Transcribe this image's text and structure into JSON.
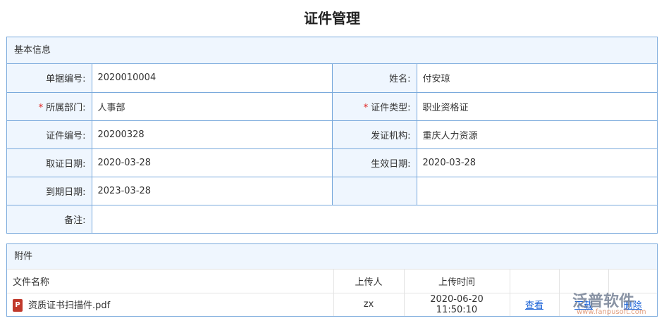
{
  "title": "证件管理",
  "basic": {
    "header": "基本信息",
    "fields": [
      {
        "label": "单据编号:",
        "value": "2020010004",
        "label2": "姓名:",
        "value2": "付安琼"
      },
      {
        "label": "所属部门:",
        "value": "人事部",
        "label2": "证件类型:",
        "value2": "职业资格证",
        "required": true
      },
      {
        "label": "证件编号:",
        "value": "20200328",
        "label2": "发证机构:",
        "value2": "重庆人力资源"
      },
      {
        "label": "取证日期:",
        "value": "2020-03-28",
        "label2": "生效日期:",
        "value2": "2020-03-28"
      },
      {
        "label": "到期日期:",
        "value": "2023-03-28",
        "label2": "",
        "value2": ""
      }
    ],
    "remark_label": "备注:",
    "remark_value": "",
    "required_mark": "*"
  },
  "attachments": {
    "header": "附件",
    "columns": [
      "文件名称",
      "上传人",
      "上传时间"
    ],
    "rows": [
      {
        "name": "资质证书扫描件.pdf",
        "uploader": "zx",
        "time": "2020-06-20 11:50:10",
        "view": "查看",
        "download": "下载",
        "delete": "删除"
      }
    ]
  },
  "watermark": {
    "text": "泛普软件",
    "url": "www.fanpusoft.com"
  }
}
